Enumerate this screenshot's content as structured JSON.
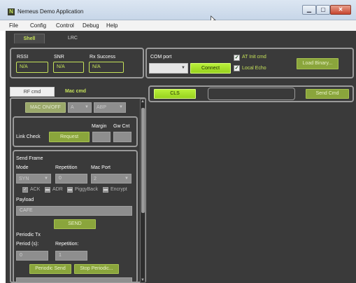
{
  "window": {
    "title": "Nemeus Demo Application",
    "app_icon_letter": "N",
    "min_glyph": "▁",
    "max_glyph": "▢",
    "close_glyph": "✕"
  },
  "menu": [
    "File",
    "Config",
    "Control",
    "Debug",
    "Help"
  ],
  "tabs": {
    "active": "Shell",
    "inactive": "LRC"
  },
  "status": {
    "rssi_label": "RSSI",
    "rssi_value": "N/A",
    "snr_label": "SNR",
    "snr_value": "N/A",
    "rx_label": "Rx Success",
    "rx_value": "N/A"
  },
  "com": {
    "port_label": "COM port",
    "port_value": "",
    "connect_label": "Connect",
    "at_init_label": "AT Init cmd",
    "local_echo_label": "Local Echo",
    "load_binary_label": "Load Binary..."
  },
  "subtabs": {
    "active": "RF cmd",
    "inactive": "Mac cmd"
  },
  "mac": {
    "onoff_label": "MAC ON/OFF",
    "class_value": "A",
    "mode_value": "ABP"
  },
  "link_check": {
    "label": "Link Check",
    "request_label": "Request",
    "margin_label": "Margin",
    "gwcnt_label": "Gw Cnt"
  },
  "send_frame": {
    "title": "Send Frame",
    "mode_label": "Mode",
    "repetition_label": "Repetition",
    "macport_label": "Mac Port",
    "mode_value": "SYN",
    "repetition_value": "0",
    "macport_value": "2",
    "ack_label": "ACK",
    "adr_label": "ADR",
    "piggyback_label": "PiggyBack",
    "encrypt_label": "Encrypt",
    "payload_label": "Payload",
    "payload_value": "CAFE",
    "send_label": "SEND"
  },
  "periodic": {
    "title": "Periodic Tx",
    "period_label": "Period (s):",
    "repetition_label": "Repetition:",
    "period_value": "0",
    "repetition_value": "1",
    "periodic_send_label": "Periodic Send",
    "stop_label": "Stop Periodic..."
  },
  "console": {
    "cls_label": "CLS",
    "cmd_value": "",
    "send_cmd_label": "Send Cmd"
  },
  "colors": {
    "accent": "#c6e35a",
    "background": "#3a3a3a",
    "button_green": "#8aa53c",
    "button_bright": "#a6e22b"
  }
}
